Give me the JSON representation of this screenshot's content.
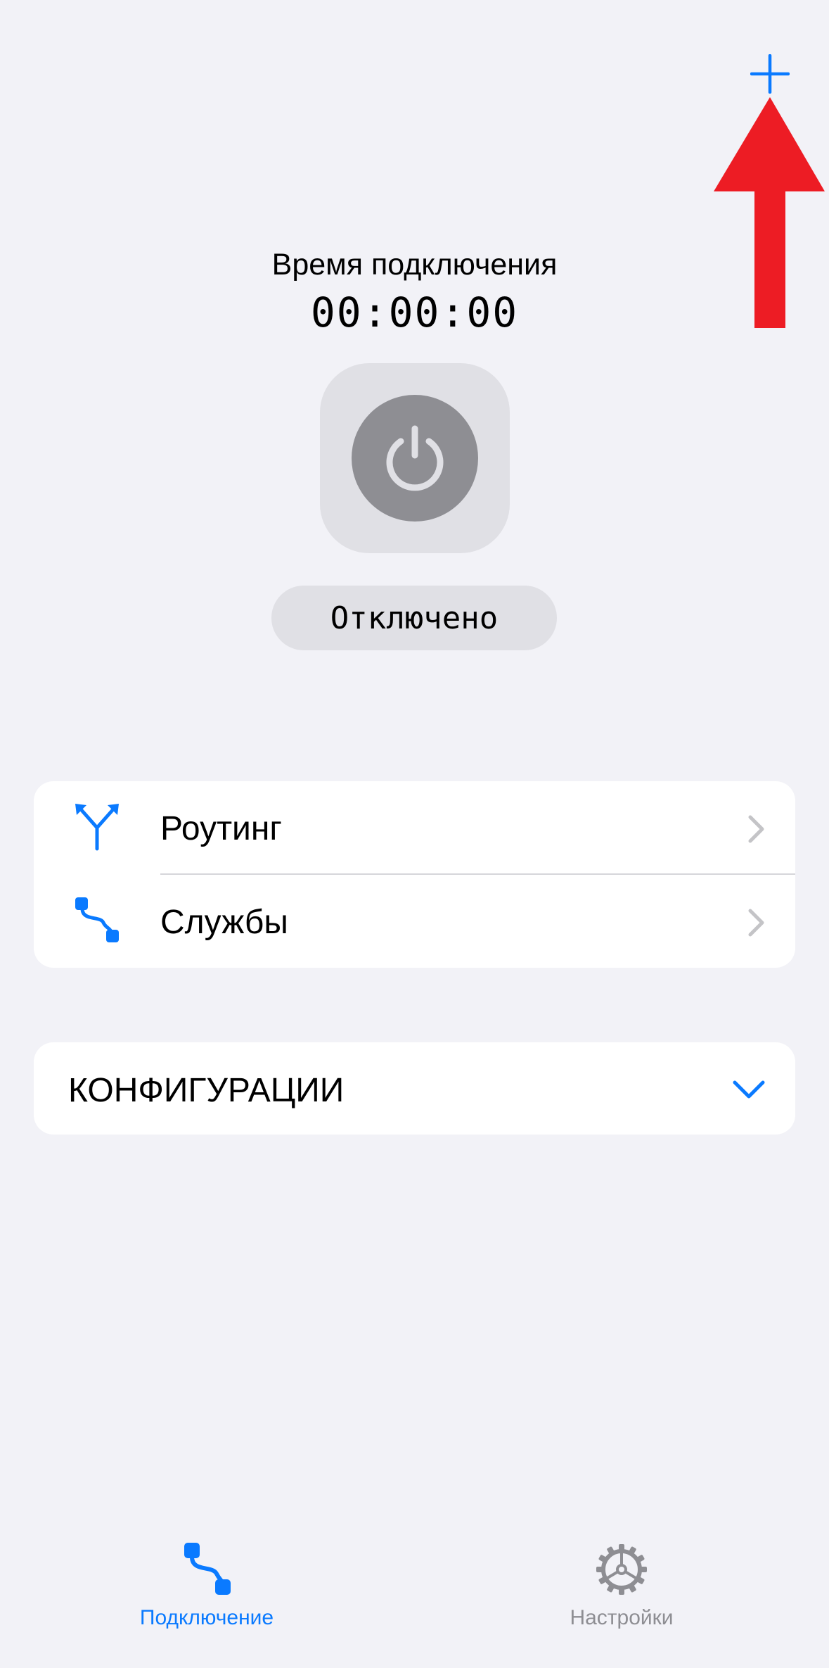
{
  "colors": {
    "accent": "#0a7aff",
    "background": "#f2f2f7",
    "inactive": "#8e8e93",
    "annotation": "#ed1c24"
  },
  "header": {
    "add_icon": "plus-icon"
  },
  "timer": {
    "label": "Время подключения",
    "value": "00:00:00"
  },
  "power": {
    "icon": "power-icon",
    "status": "Отключено"
  },
  "menu": {
    "items": [
      {
        "label": "Роутинг",
        "icon": "routing-icon"
      },
      {
        "label": "Службы",
        "icon": "services-icon"
      }
    ]
  },
  "configs": {
    "label": "КОНФИГУРАЦИИ",
    "icon": "chevron-down-icon"
  },
  "tabbar": {
    "tabs": [
      {
        "label": "Подключение",
        "icon": "connection-icon",
        "active": true
      },
      {
        "label": "Настройки",
        "icon": "gear-icon",
        "active": false
      }
    ]
  }
}
